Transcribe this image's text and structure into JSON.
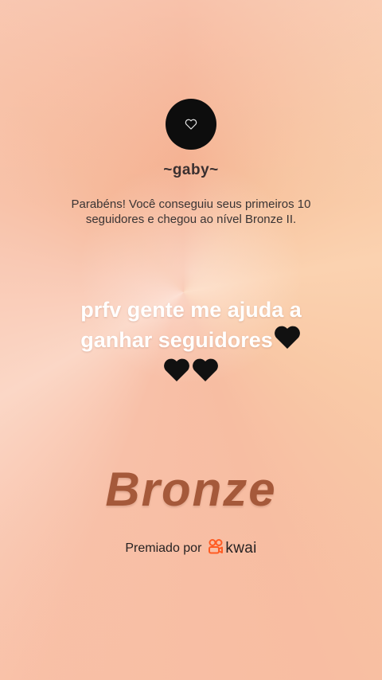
{
  "profile": {
    "username": "~gaby~",
    "avatar_icon": "heart-outline-icon"
  },
  "achievement": {
    "message": "Parabéns! Você conseguiu seus primeiros 10 seguidores e chegou ao nível Bronze II.",
    "level_title": "Bronze"
  },
  "caption": {
    "line1": "prfv gente me ajuda a",
    "line2": "ganhar seguidores"
  },
  "footer": {
    "awarded_by": "Premiado por",
    "brand": "kwai"
  },
  "colors": {
    "bronze_text": "#a5593a",
    "kwai_orange": "#ff5b22",
    "heart": "#111111"
  }
}
